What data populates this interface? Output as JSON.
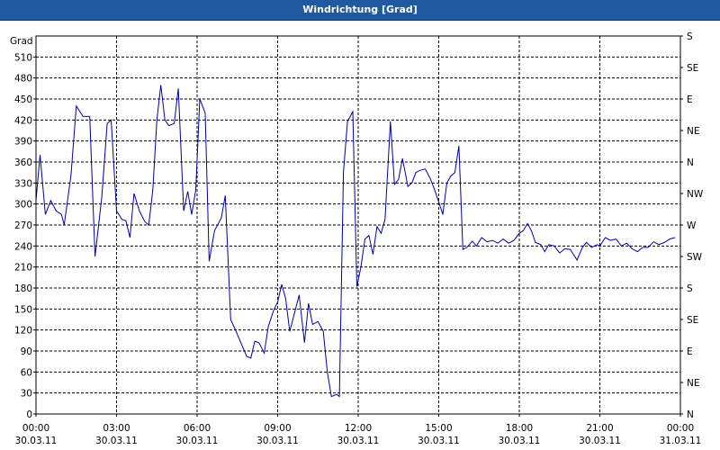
{
  "window": {
    "title": "Windrichtung [Grad]"
  },
  "chart_data": {
    "type": "line",
    "title": "Windrichtung [Grad]",
    "ylabel": "Grad",
    "ylim": [
      0,
      540
    ],
    "yticks": [
      0,
      30,
      60,
      90,
      120,
      150,
      180,
      210,
      240,
      270,
      300,
      330,
      360,
      390,
      420,
      450,
      480,
      510
    ],
    "xlim": [
      0,
      24
    ],
    "xticks": [
      {
        "x": 0,
        "time": "00:00",
        "date": "30.03.11"
      },
      {
        "x": 3,
        "time": "03:00",
        "date": "30.03.11"
      },
      {
        "x": 6,
        "time": "06:00",
        "date": "30.03.11"
      },
      {
        "x": 9,
        "time": "09:00",
        "date": "30.03.11"
      },
      {
        "x": 12,
        "time": "12:00",
        "date": "30.03.11"
      },
      {
        "x": 15,
        "time": "15:00",
        "date": "30.03.11"
      },
      {
        "x": 18,
        "time": "18:00",
        "date": "30.03.11"
      },
      {
        "x": 21,
        "time": "21:00",
        "date": "30.03.11"
      },
      {
        "x": 24,
        "time": "00:00",
        "date": "31.03.11"
      }
    ],
    "right_axis": [
      {
        "y": 0,
        "label": "N"
      },
      {
        "y": 45,
        "label": "NE"
      },
      {
        "y": 90,
        "label": "E"
      },
      {
        "y": 135,
        "label": "SE"
      },
      {
        "y": 180,
        "label": "S"
      },
      {
        "y": 225,
        "label": "SW"
      },
      {
        "y": 270,
        "label": "W"
      },
      {
        "y": 315,
        "label": "NW"
      },
      {
        "y": 360,
        "label": "N"
      },
      {
        "y": 405,
        "label": "NE"
      },
      {
        "y": 450,
        "label": "E"
      },
      {
        "y": 495,
        "label": "SE"
      },
      {
        "y": 540,
        "label": "S"
      }
    ],
    "grid": true,
    "line_color": "#0000a0",
    "series": [
      {
        "name": "",
        "points": [
          [
            0.0,
            305
          ],
          [
            0.15,
            370
          ],
          [
            0.35,
            285
          ],
          [
            0.55,
            305
          ],
          [
            0.75,
            290
          ],
          [
            0.95,
            285
          ],
          [
            1.05,
            270
          ],
          [
            1.3,
            340
          ],
          [
            1.5,
            440
          ],
          [
            1.75,
            425
          ],
          [
            2.0,
            425
          ],
          [
            2.2,
            225
          ],
          [
            2.45,
            310
          ],
          [
            2.65,
            415
          ],
          [
            2.8,
            420
          ],
          [
            3.0,
            290
          ],
          [
            3.2,
            278
          ],
          [
            3.35,
            276
          ],
          [
            3.5,
            252
          ],
          [
            3.65,
            315
          ],
          [
            3.85,
            290
          ],
          [
            4.05,
            275
          ],
          [
            4.2,
            270
          ],
          [
            4.35,
            320
          ],
          [
            4.5,
            420
          ],
          [
            4.65,
            470
          ],
          [
            4.8,
            420
          ],
          [
            4.95,
            412
          ],
          [
            5.15,
            415
          ],
          [
            5.3,
            465
          ],
          [
            5.5,
            290
          ],
          [
            5.65,
            318
          ],
          [
            5.8,
            285
          ],
          [
            5.95,
            320
          ],
          [
            6.1,
            450
          ],
          [
            6.3,
            430
          ],
          [
            6.45,
            218
          ],
          [
            6.65,
            262
          ],
          [
            6.9,
            280
          ],
          [
            7.05,
            312
          ],
          [
            7.25,
            135
          ],
          [
            7.45,
            118
          ],
          [
            7.65,
            100
          ],
          [
            7.85,
            82
          ],
          [
            8.0,
            80
          ],
          [
            8.15,
            104
          ],
          [
            8.3,
            102
          ],
          [
            8.5,
            87
          ],
          [
            8.65,
            125
          ],
          [
            8.85,
            148
          ],
          [
            9.0,
            160
          ],
          [
            9.15,
            185
          ],
          [
            9.3,
            165
          ],
          [
            9.45,
            118
          ],
          [
            9.6,
            140
          ],
          [
            9.8,
            170
          ],
          [
            10.0,
            102
          ],
          [
            10.15,
            158
          ],
          [
            10.3,
            128
          ],
          [
            10.5,
            132
          ],
          [
            10.7,
            118
          ],
          [
            10.85,
            60
          ],
          [
            11.0,
            25
          ],
          [
            11.2,
            28
          ],
          [
            11.3,
            25
          ],
          [
            11.45,
            345
          ],
          [
            11.6,
            418
          ],
          [
            11.8,
            432
          ],
          [
            11.95,
            182
          ],
          [
            12.1,
            210
          ],
          [
            12.25,
            250
          ],
          [
            12.4,
            255
          ],
          [
            12.55,
            228
          ],
          [
            12.7,
            268
          ],
          [
            12.85,
            258
          ],
          [
            13.0,
            278
          ],
          [
            13.2,
            418
          ],
          [
            13.35,
            328
          ],
          [
            13.5,
            335
          ],
          [
            13.65,
            365
          ],
          [
            13.85,
            325
          ],
          [
            14.0,
            330
          ],
          [
            14.15,
            345
          ],
          [
            14.3,
            348
          ],
          [
            14.5,
            350
          ],
          [
            14.7,
            335
          ],
          [
            14.85,
            320
          ],
          [
            15.0,
            303
          ],
          [
            15.15,
            285
          ],
          [
            15.3,
            330
          ],
          [
            15.45,
            340
          ],
          [
            15.6,
            345
          ],
          [
            15.75,
            383
          ],
          [
            15.9,
            235
          ],
          [
            16.05,
            238
          ],
          [
            16.25,
            247
          ],
          [
            16.4,
            240
          ],
          [
            16.6,
            252
          ],
          [
            16.8,
            246
          ],
          [
            17.0,
            248
          ],
          [
            17.2,
            244
          ],
          [
            17.4,
            250
          ],
          [
            17.6,
            244
          ],
          [
            17.8,
            248
          ],
          [
            18.0,
            258
          ],
          [
            18.15,
            262
          ],
          [
            18.3,
            272
          ],
          [
            18.45,
            262
          ],
          [
            18.6,
            245
          ],
          [
            18.8,
            242
          ],
          [
            18.95,
            232
          ],
          [
            19.1,
            242
          ],
          [
            19.3,
            240
          ],
          [
            19.5,
            230
          ],
          [
            19.7,
            236
          ],
          [
            19.9,
            235
          ],
          [
            20.15,
            220
          ],
          [
            20.35,
            238
          ],
          [
            20.5,
            245
          ],
          [
            20.7,
            238
          ],
          [
            20.9,
            242
          ],
          [
            21.0,
            240
          ],
          [
            21.2,
            252
          ],
          [
            21.4,
            248
          ],
          [
            21.6,
            250
          ],
          [
            21.8,
            240
          ],
          [
            22.0,
            244
          ],
          [
            22.2,
            236
          ],
          [
            22.4,
            232
          ],
          [
            22.6,
            238
          ],
          [
            22.8,
            238
          ],
          [
            23.0,
            246
          ],
          [
            23.2,
            242
          ],
          [
            23.4,
            245
          ],
          [
            23.6,
            250
          ],
          [
            23.8,
            252
          ]
        ]
      }
    ]
  }
}
